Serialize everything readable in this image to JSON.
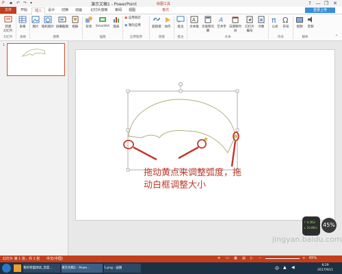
{
  "title_bar": {
    "title": "演示文稿1 - PowerPoint",
    "context_tab": "绘图工具",
    "help": "?",
    "minimize": "—",
    "restore": "❐",
    "close": "✕"
  },
  "tabs": [
    {
      "label": "文件"
    },
    {
      "label": "开始"
    },
    {
      "label": "插入"
    },
    {
      "label": "设计"
    },
    {
      "label": "切换"
    },
    {
      "label": "动画"
    },
    {
      "label": "幻灯片放映"
    },
    {
      "label": "审阅"
    },
    {
      "label": "视图"
    },
    {
      "label": "格式"
    }
  ],
  "login": "登录上传",
  "ribbon": {
    "buttons": [
      {
        "label": "新建\n幻灯片",
        "icon": "new-slide-icon"
      },
      {
        "label": "表格",
        "icon": "table-icon"
      },
      {
        "label": "图片",
        "icon": "picture-icon"
      },
      {
        "label": "联机图片",
        "icon": "online-picture-icon"
      },
      {
        "label": "屏幕截图",
        "icon": "screenshot-icon"
      },
      {
        "label": "相册",
        "icon": "album-icon"
      },
      {
        "label": "形状",
        "icon": "shapes-icon"
      },
      {
        "label": "SmartArt",
        "icon": "smartart-icon"
      },
      {
        "label": "图表",
        "icon": "chart-icon"
      },
      {
        "label": "应用商店",
        "icon": "store-icon"
      },
      {
        "label": "我的应用",
        "icon": "my-apps-icon"
      },
      {
        "label": "超链接",
        "icon": "hyperlink-icon"
      },
      {
        "label": "动作",
        "icon": "action-icon"
      },
      {
        "label": "批注",
        "icon": "comment-icon"
      },
      {
        "label": "文本框",
        "icon": "textbox-icon"
      },
      {
        "label": "页眉和页脚",
        "icon": "header-footer-icon"
      },
      {
        "label": "艺术字",
        "icon": "wordart-icon"
      },
      {
        "label": "日期和时间",
        "icon": "datetime-icon"
      },
      {
        "label": "幻灯片\n编号",
        "icon": "slide-number-icon"
      },
      {
        "label": "对象",
        "icon": "object-icon"
      },
      {
        "label": "公式",
        "icon": "equation-icon"
      },
      {
        "label": "符号",
        "icon": "symbol-icon"
      },
      {
        "label": "视频",
        "icon": "video-icon"
      },
      {
        "label": "音频",
        "icon": "audio-icon"
      }
    ],
    "groups": [
      "幻灯片",
      "表格",
      "图像",
      "插图",
      "应用程序",
      "链接",
      "批注",
      "文本",
      "符号",
      "媒体"
    ]
  },
  "thumbnail": {
    "number": "1"
  },
  "annotation": "拖动黄点来调整弧度，拖动白框调整大小",
  "status": {
    "slide_info": "幻灯片 第 1 张，共 1 张",
    "language": "中文(中国)",
    "zoom": "65%"
  },
  "timer": {
    "percent": "45%",
    "up": "↑ 0.2K/s",
    "down": "↓ 10.8K/s"
  },
  "taskbar": {
    "items": [
      "我的卷面测试_百度...",
      "演示文稿1 - Powe...",
      "1.png - 画图"
    ],
    "time": "8:29",
    "date": "2017/9/11"
  },
  "watermark": "jingyan.baidu.com",
  "colors": {
    "accent": "#c43e1c",
    "annotation": "#c0392b",
    "shape": "#a8b07a"
  }
}
